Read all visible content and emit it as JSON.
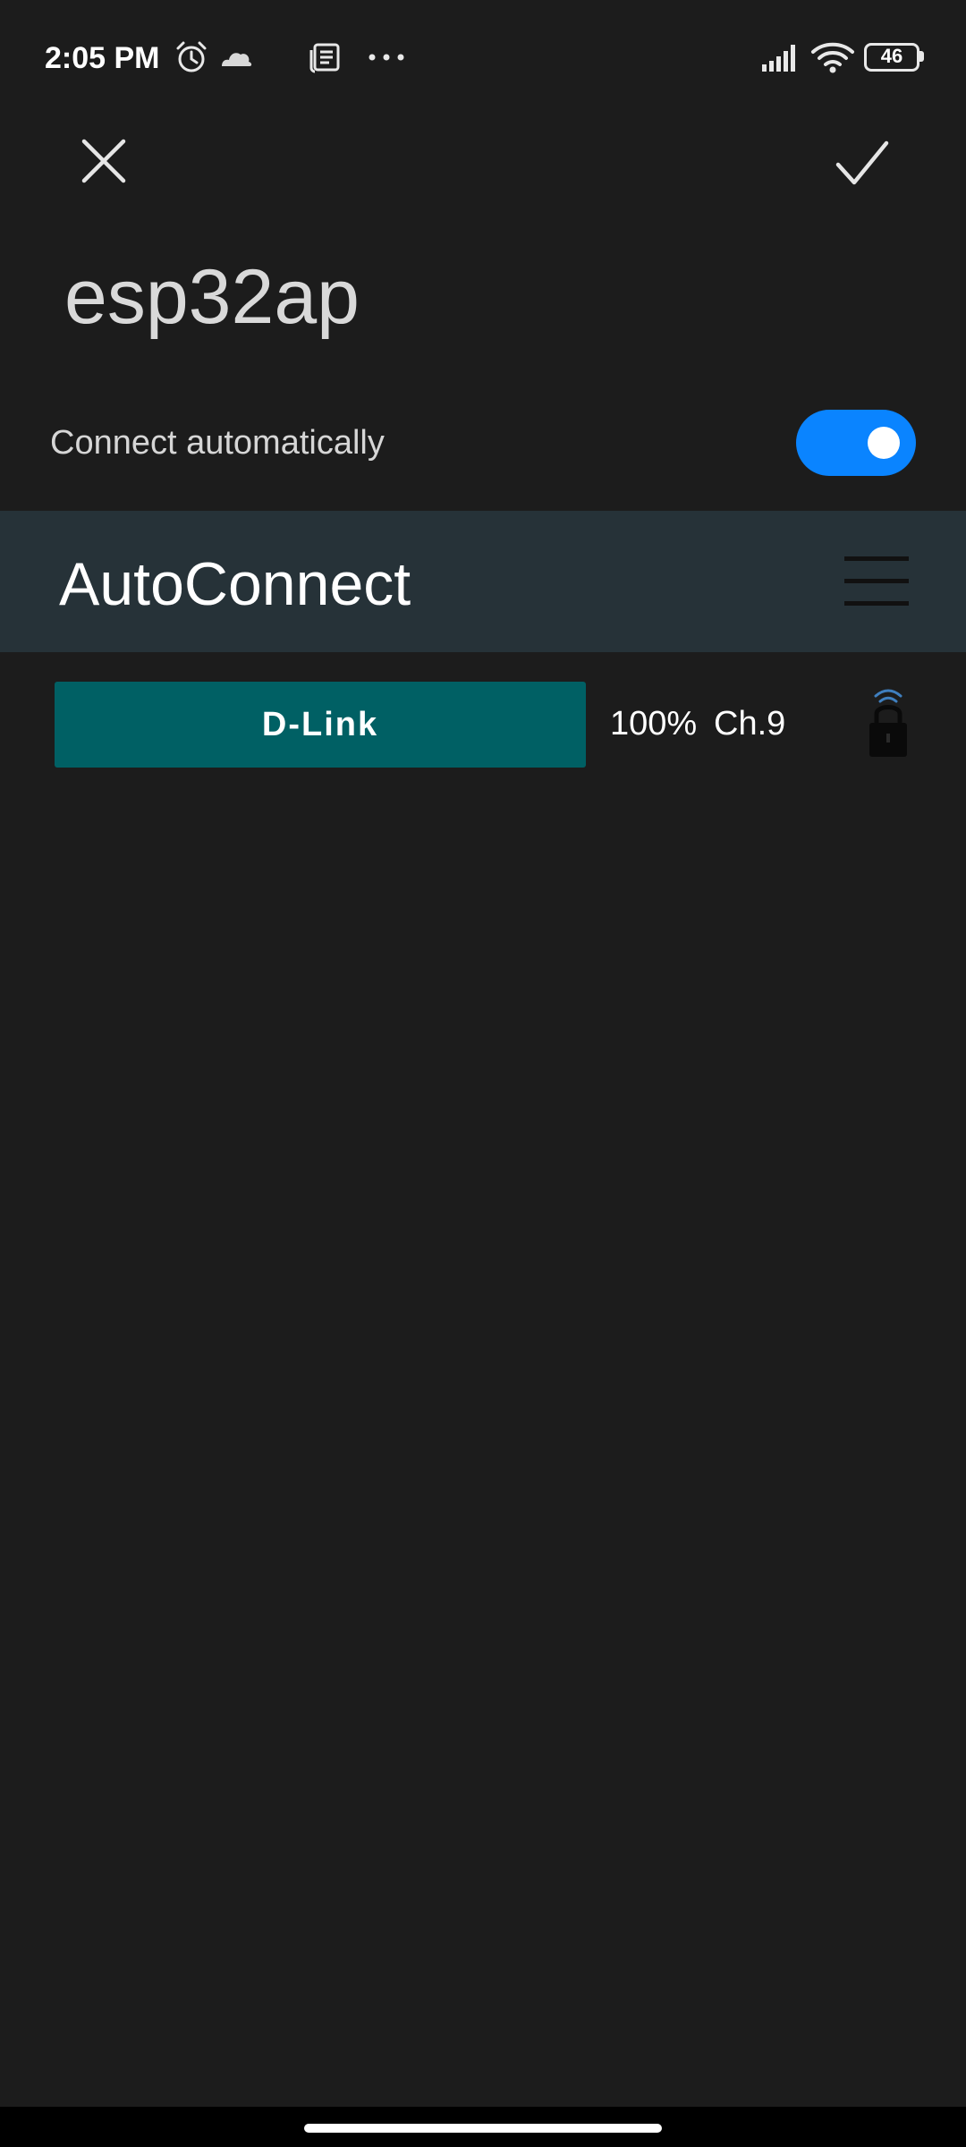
{
  "status_bar": {
    "time": "2:05 PM",
    "battery": "46",
    "icons": [
      "alarm-icon",
      "cloud-icon",
      "news-icon",
      "more-dots-icon",
      "signal-icon",
      "wifi-icon",
      "battery-icon"
    ]
  },
  "dialog": {
    "network_name": "esp32ap",
    "auto_connect_label": "Connect automatically",
    "auto_connect_on": true,
    "toggle_color": "#0a84ff"
  },
  "web": {
    "title": "AutoConnect",
    "header_color": "#263238",
    "networks": [
      {
        "ssid": "D-Link",
        "strength": "100%",
        "channel": "Ch.9",
        "button_color": "#006064"
      }
    ]
  }
}
